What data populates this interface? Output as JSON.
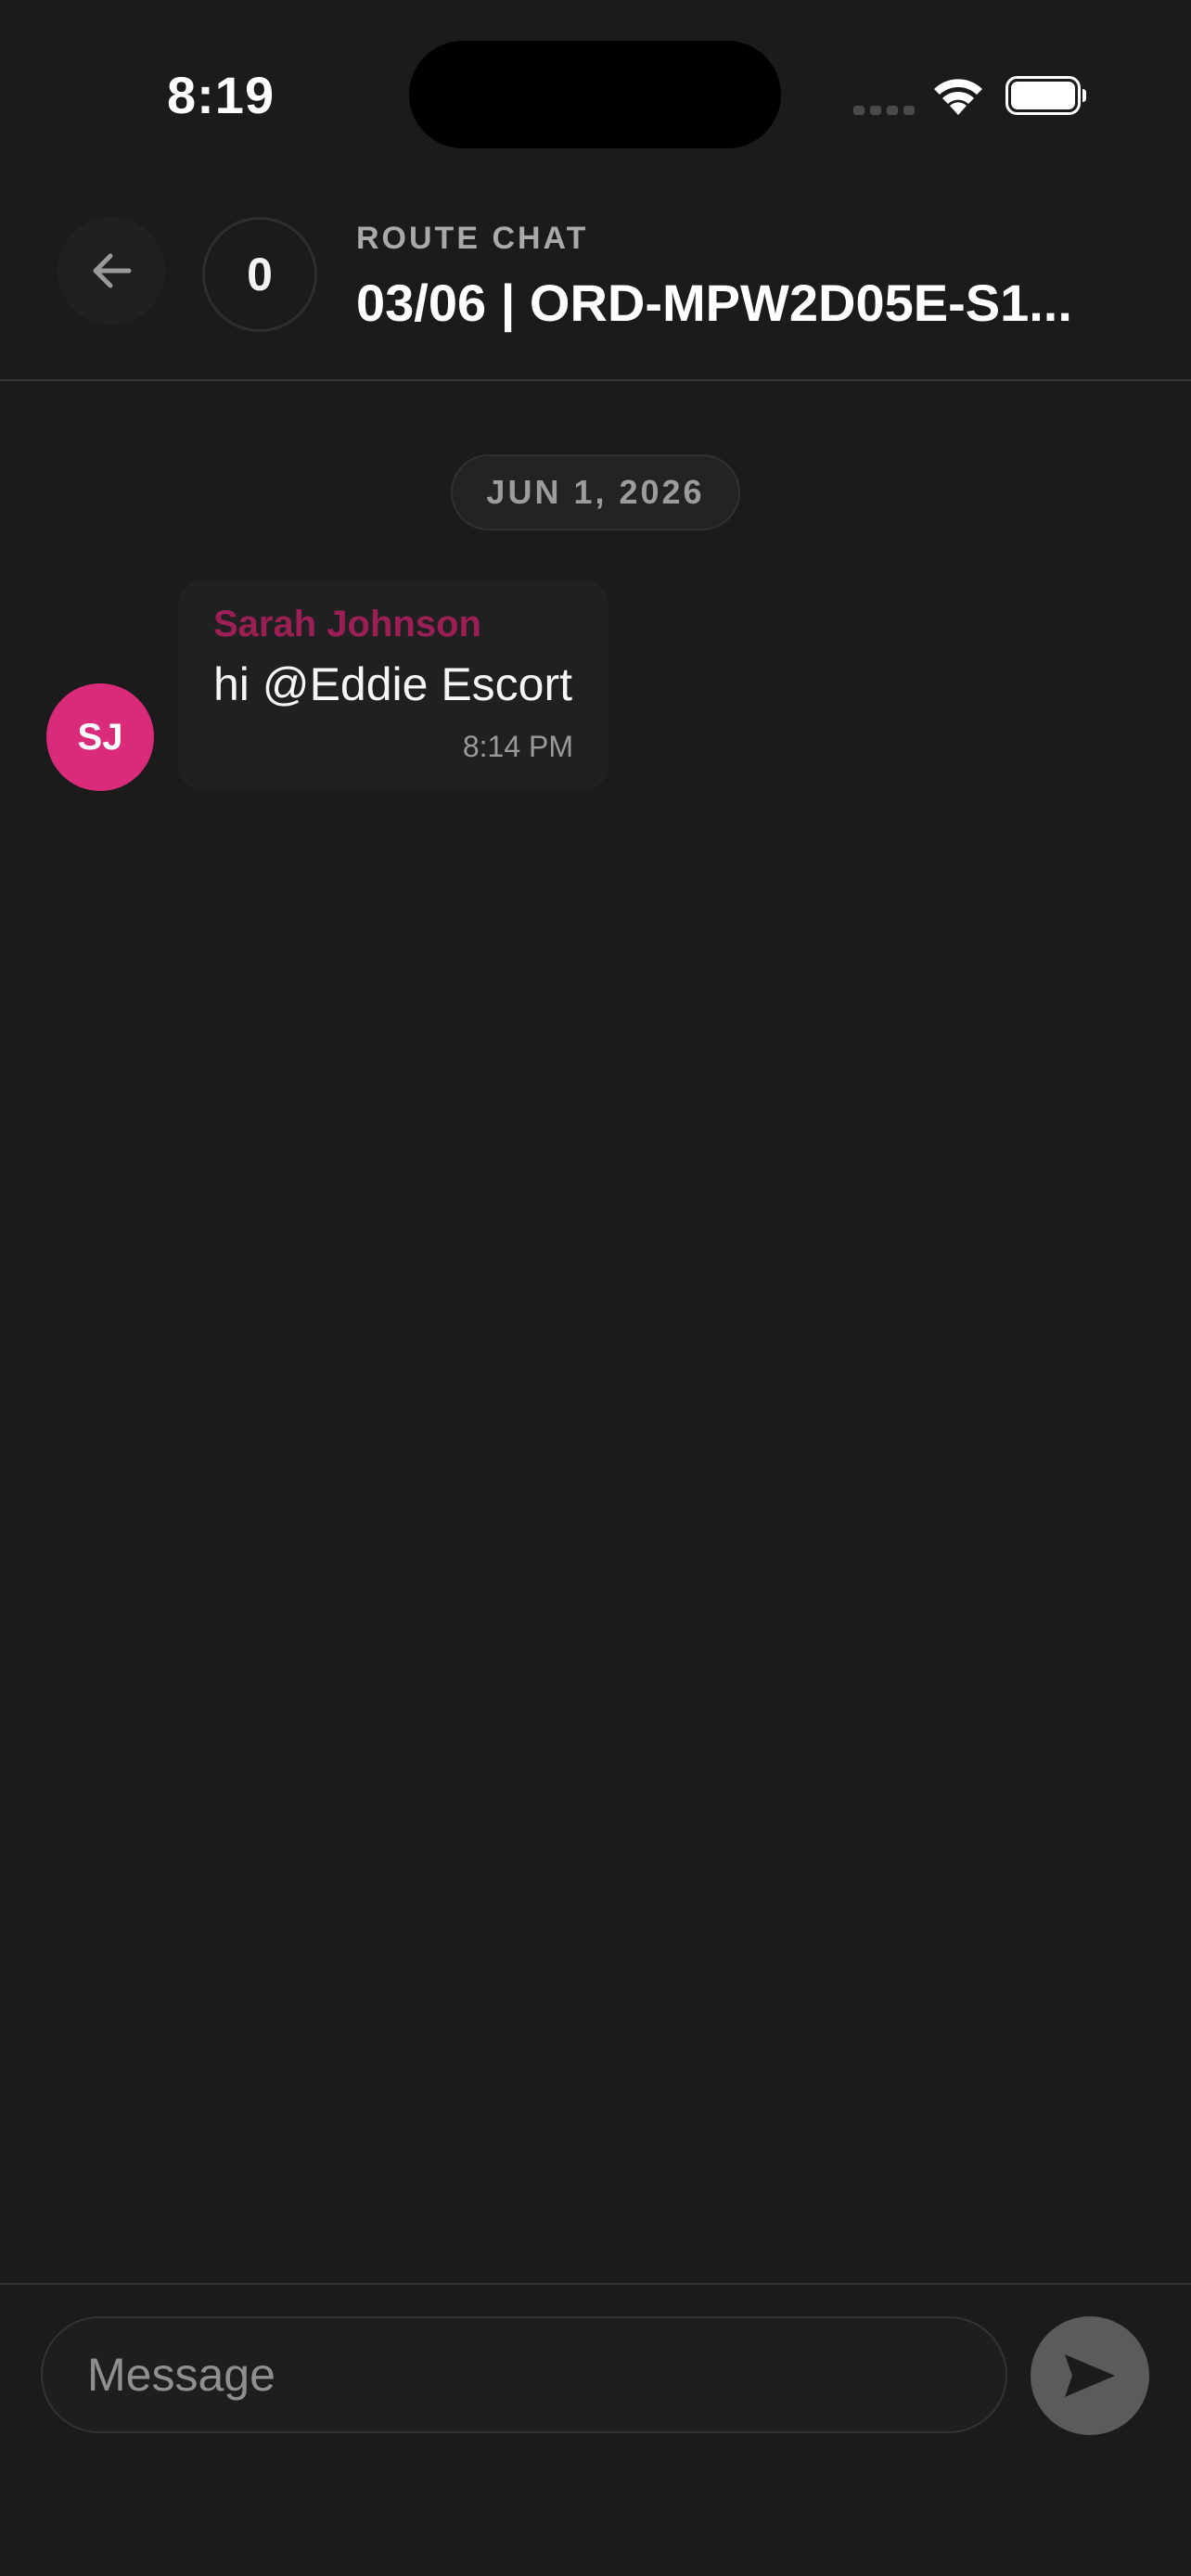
{
  "status_bar": {
    "time": "8:19",
    "icons": [
      "signal-icon",
      "wifi-icon",
      "battery-icon"
    ]
  },
  "header": {
    "back_icon": "arrow-left-icon",
    "count": "0",
    "kicker": "ROUTE CHAT",
    "title": "03/06 | ORD-MPW2D05E-S1..."
  },
  "messages": {
    "date_separator": "JUN 1, 2026",
    "items": [
      {
        "avatar_initials": "SJ",
        "avatar_color": "#d92b7a",
        "sender": "Sarah Johnson",
        "sender_color": "#9b1f55",
        "text": "hi @Eddie Escort",
        "time": "8:14 PM"
      }
    ]
  },
  "composer": {
    "placeholder": "Message",
    "value": "",
    "send_icon": "send-icon"
  },
  "colors": {
    "background": "#1b1b1b",
    "bubble": "#202020",
    "send_button": "#5b5b5b"
  }
}
